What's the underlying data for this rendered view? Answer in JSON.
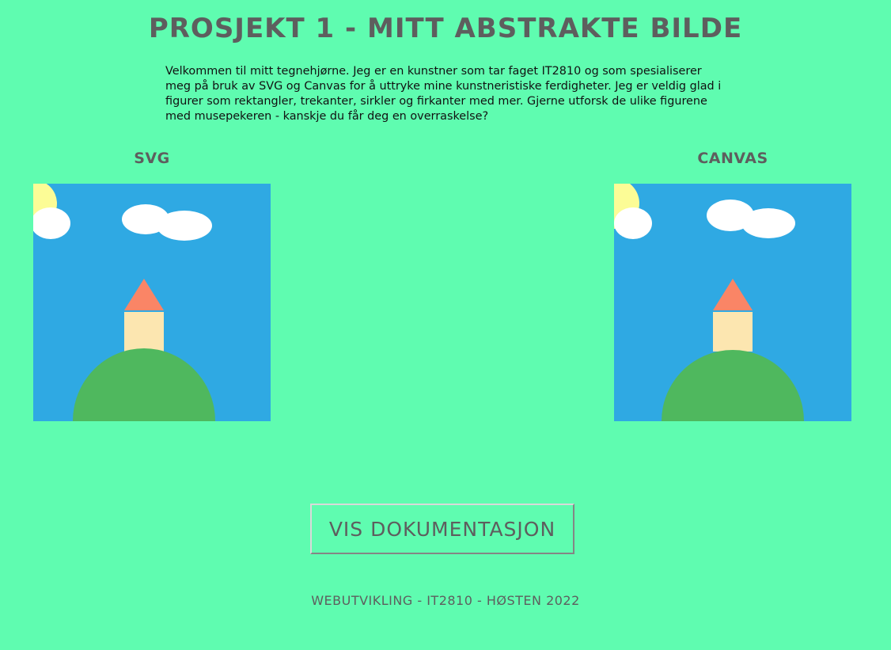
{
  "header": {
    "title": "PROSJEKT 1 - MITT ABSTRAKTE BILDE"
  },
  "intro": {
    "text": "Velkommen til mitt tegnehjørne. Jeg er en kunstner som tar faget IT2810 og som spesialiserer meg på bruk av SVG og Canvas for å uttryke mine kunstneristiske ferdigheter. Jeg er veldig glad i figurer som rektangler, trekanter, sirkler og firkanter med mer. Gjerne utforsk de ulike figurene med musepekeren - kanskje du får deg en overraskelse?"
  },
  "panels": {
    "svg": {
      "heading": "SVG"
    },
    "canvas": {
      "heading": "CANVAS"
    }
  },
  "artwork": {
    "colors": {
      "sky": "#2fa9e3",
      "sun": "#fcfc96",
      "cloud": "#ffffff",
      "roof": "#fa8566",
      "tower": "#fce6b0",
      "hill": "#4fb85e"
    }
  },
  "button": {
    "label": "VIS DOKUMENTASJON"
  },
  "footer": {
    "text": "WEBUTVIKLING - IT2810 - HØSTEN 2022"
  }
}
